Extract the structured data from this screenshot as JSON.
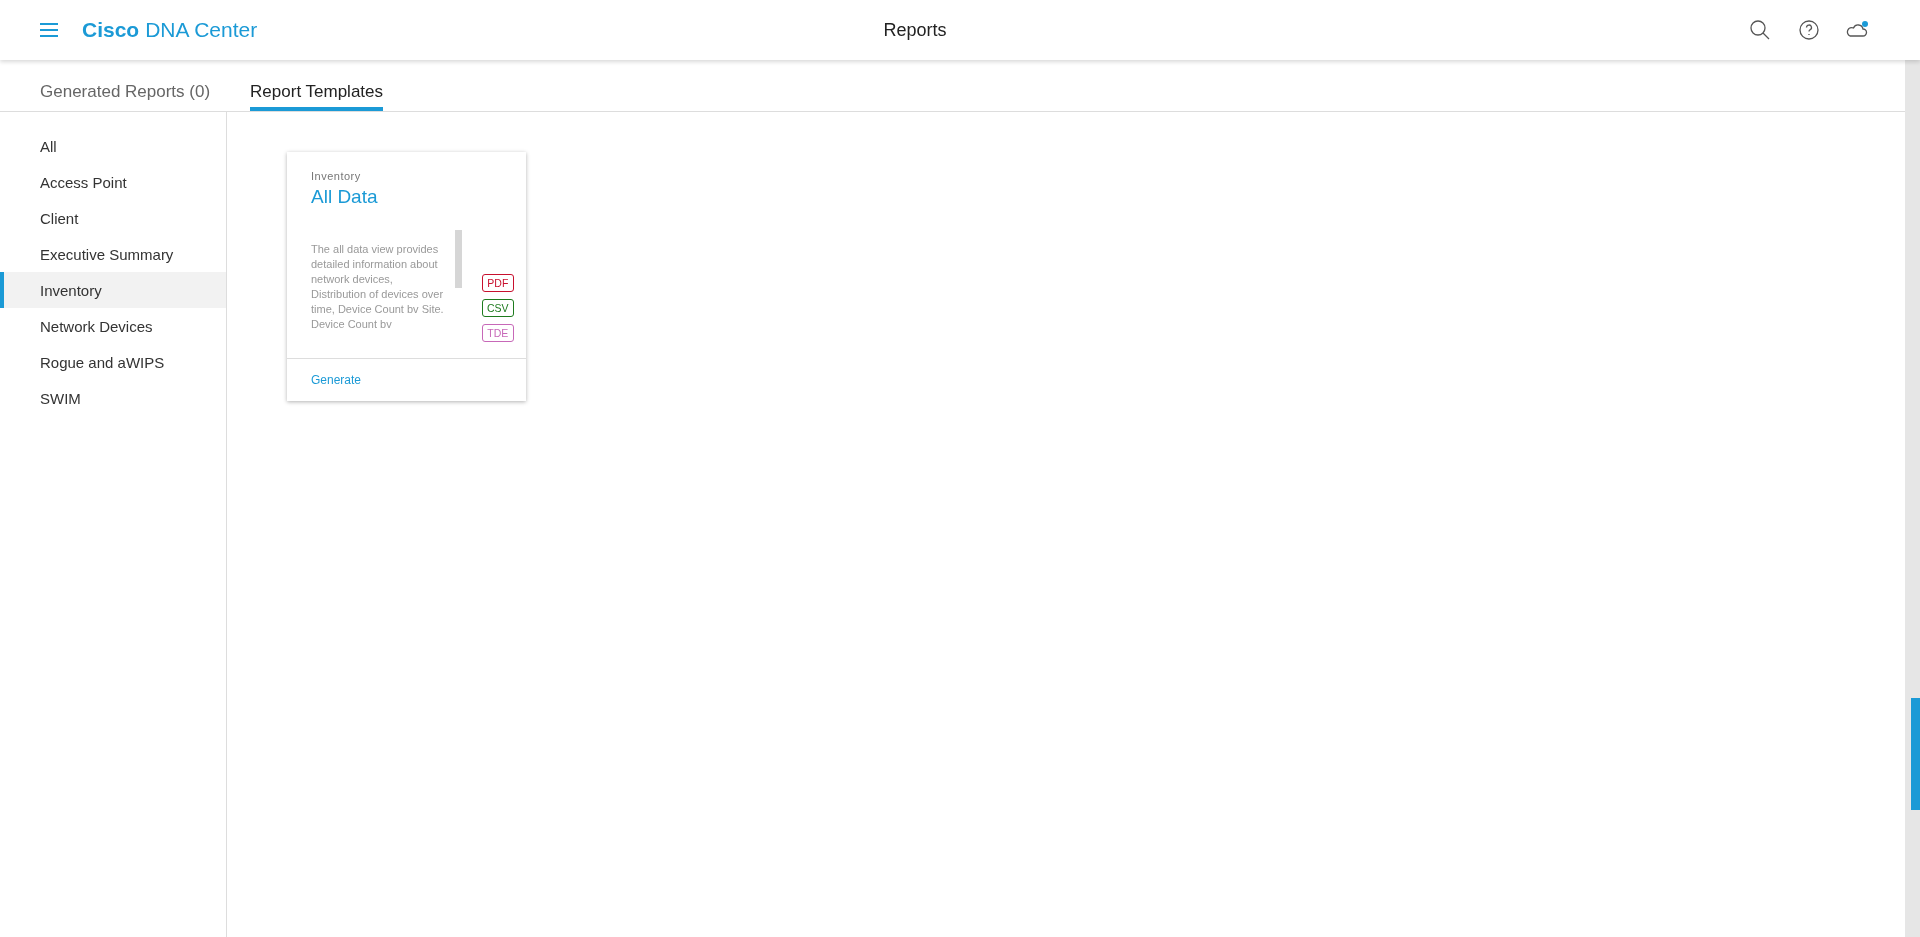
{
  "header": {
    "brand_bold": "Cisco",
    "brand_rest": "DNA Center",
    "title": "Reports",
    "notification": true
  },
  "tabs": [
    {
      "label": "Generated Reports (0)",
      "selected": false
    },
    {
      "label": "Report Templates",
      "selected": true
    }
  ],
  "sidebar": {
    "items": [
      {
        "label": "All",
        "selected": false
      },
      {
        "label": "Access Point",
        "selected": false
      },
      {
        "label": "Client",
        "selected": false
      },
      {
        "label": "Executive Summary",
        "selected": false
      },
      {
        "label": "Inventory",
        "selected": true
      },
      {
        "label": "Network Devices",
        "selected": false
      },
      {
        "label": "Rogue and aWIPS",
        "selected": false
      },
      {
        "label": "SWIM",
        "selected": false
      }
    ]
  },
  "cards": [
    {
      "category": "Inventory",
      "title": "All Data",
      "description": "The all data view provides detailed information about network devices, Distribution of devices over time, Device Count bv Site. Device Count bv",
      "formats": [
        {
          "label": "PDF",
          "color": "#c8102e"
        },
        {
          "label": "CSV",
          "color": "#1e7b1e"
        },
        {
          "label": "TDE",
          "color": "#c768b8"
        }
      ],
      "action": "Generate"
    }
  ]
}
